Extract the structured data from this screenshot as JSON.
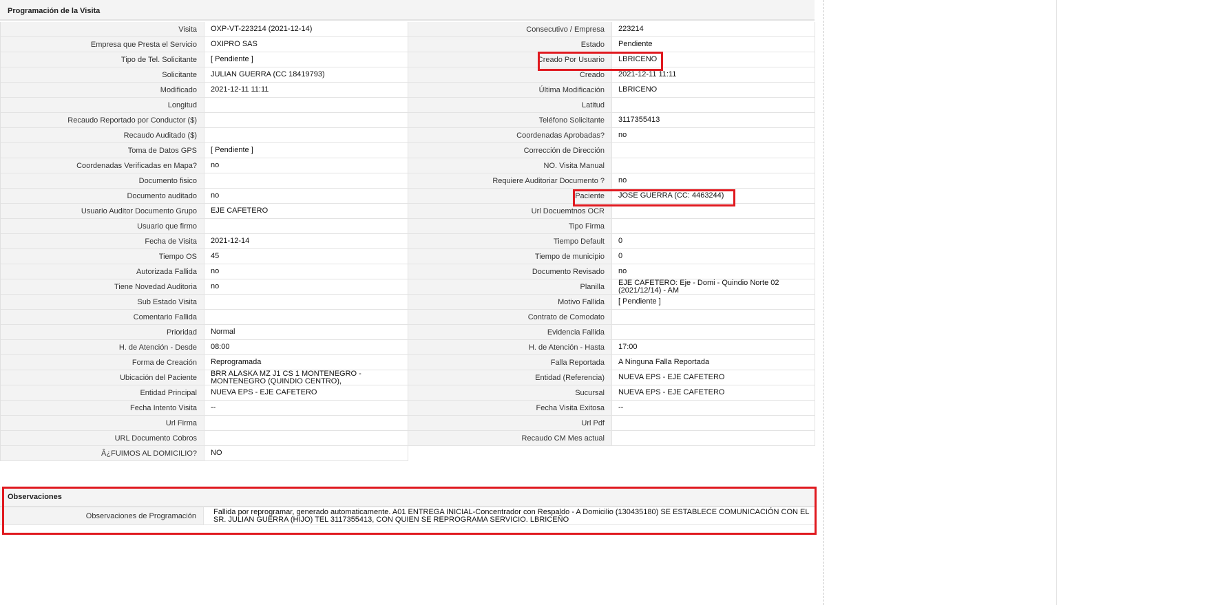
{
  "section": {
    "title": "Programación de la Visita"
  },
  "rows": [
    {
      "l1": "Visita",
      "v1": "OXP-VT-223214 (2021-12-14)",
      "l2": "Consecutivo / Empresa",
      "v2": "223214"
    },
    {
      "l1": "Empresa que Presta el Servicio",
      "v1": "OXIPRO SAS",
      "l2": "Estado",
      "v2": "Pendiente"
    },
    {
      "l1": "Tipo de Tel. Solicitante",
      "v1": "[ Pendiente ]",
      "l2": "Creado Por Usuario",
      "v2": "LBRICENO"
    },
    {
      "l1": "Solicitante",
      "v1": "JULIAN GUERRA (CC 18419793)",
      "l2": "Creado",
      "v2": "2021-12-11 11:11"
    },
    {
      "l1": "Modificado",
      "v1": "2021-12-11 11:11",
      "l2": "Última Modificación",
      "v2": " LBRICENO"
    },
    {
      "l1": "Longitud",
      "v1": "",
      "l2": "Latitud",
      "v2": ""
    },
    {
      "l1": "Recaudo Reportado por Conductor ($)",
      "v1": "",
      "l2": "Teléfono Solicitante",
      "v2": "3117355413"
    },
    {
      "l1": "Recaudo Auditado ($)",
      "v1": "",
      "l2": "Coordenadas Aprobadas?",
      "v2": " no"
    },
    {
      "l1": "Toma de Datos GPS",
      "v1": "[ Pendiente ]",
      "l2": "Corrección de Dirección",
      "v2": ""
    },
    {
      "l1": "Coordenadas Verificadas en Mapa?",
      "v1": " no",
      "l2": "NO. Visita Manual",
      "v2": ""
    },
    {
      "l1": "Documento fisico",
      "v1": "",
      "l2": "Requiere Auditoriar Documento ?",
      "v2": " no"
    },
    {
      "l1": "Documento auditado",
      "v1": " no",
      "l2": "Paciente",
      "v2": "JOSE GUERRA (CC: 4463244)"
    },
    {
      "l1": "Usuario Auditor Documento Grupo",
      "v1": "EJE CAFETERO",
      "l2": "Url Docuemtnos OCR",
      "v2": ""
    },
    {
      "l1": "Usuario que firmo",
      "v1": "",
      "l2": "Tipo Firma",
      "v2": ""
    },
    {
      "l1": "Fecha de Visita",
      "v1": " 2021-12-14",
      "l2": "Tiempo Default",
      "v2": "0"
    },
    {
      "l1": "Tiempo OS",
      "v1": "45",
      "l2": "Tiempo de municipio",
      "v2": "0"
    },
    {
      "l1": "Autorizada Fallida",
      "v1": " no",
      "l2": "Documento Revisado",
      "v2": " no"
    },
    {
      "l1": "Tiene Novedad Auditoria",
      "v1": " no",
      "l2": "Planilla",
      "v2": "EJE CAFETERO: Eje - Domi - Quindio Norte 02 (2021/12/14) - AM"
    },
    {
      "l1": "Sub Estado Visita",
      "v1": "",
      "l2": "Motivo Fallida",
      "v2": "[ Pendiente ]"
    },
    {
      "l1": "Comentario Fallida",
      "v1": "",
      "l2": "Contrato de Comodato",
      "v2": ""
    },
    {
      "l1": "Prioridad",
      "v1": "Normal",
      "l2": "Evidencia Fallida",
      "v2": ""
    },
    {
      "l1": "H. de Atención - Desde",
      "v1": "08:00",
      "l2": "H. de Atención - Hasta",
      "v2": "17:00"
    },
    {
      "l1": "Forma de Creación",
      "v1": "Reprogramada",
      "l2": "Falla Reportada",
      "v2": "A Ninguna Falla Reportada"
    },
    {
      "l1": "Ubicación del Paciente",
      "v1": "BRR ALASKA MZ J1 CS 1 MONTENEGRO - MONTENEGRO (QUINDIO CENTRO),",
      "l2": "Entidad (Referencia)",
      "v2": "NUEVA EPS - EJE CAFETERO"
    },
    {
      "l1": "Entidad Principal",
      "v1": "NUEVA EPS - EJE CAFETERO",
      "l2": "Sucursal",
      "v2": "NUEVA EPS - EJE CAFETERO"
    },
    {
      "l1": "Fecha Intento Visita",
      "v1": " --",
      "l2": "Fecha Visita Exitosa",
      "v2": " --"
    },
    {
      "l1": "Url Firma",
      "v1": "",
      "l2": "Url Pdf",
      "v2": ""
    },
    {
      "l1": "URL Documento Cobros",
      "v1": "",
      "l2": "Recaudo CM Mes actual",
      "v2": ""
    }
  ],
  "last_row": {
    "label": "Â¿FUIMOS AL DOMICILIO?",
    "value": "NO"
  },
  "observaciones": {
    "title": "Observaciones",
    "label": "Observaciones de Programación",
    "text": " Fallida por reprogramar, generado automaticamente. A01 ENTREGA INICIAL-Concentrador con Respaldo - A Domicilio (130435180) SE ESTABLECE COMUNICACIÓN CON EL SR. JULIAN GUERRA (HIJO) TEL 3117355413, CON QUIEN SE REPROGRAMA SERVICIO. LBRICEÑO"
  },
  "colors": {
    "highlight": "#e0191f",
    "label_bg": "#f3f3f3",
    "border": "#e3e3e3"
  }
}
